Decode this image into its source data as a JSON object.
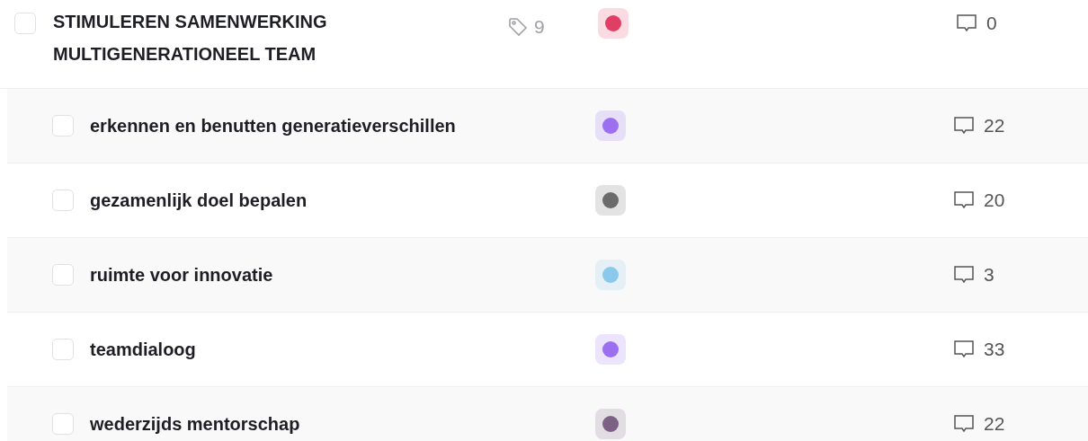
{
  "task": {
    "title": "STIMULEREN SAMENWERKING MULTIGENERATIONEEL TEAM",
    "checked": false,
    "tag_count": "9",
    "color": "#e03e62",
    "comments": "0",
    "children": [
      {
        "title": "erkennen en benutten generatieverschillen",
        "checked": false,
        "color": "#9b6ff0",
        "comments": "22"
      },
      {
        "title": "gezamenlijk doel bepalen",
        "checked": false,
        "color": "#6b6b6b",
        "comments": "20"
      },
      {
        "title": "ruimte voor innovatie",
        "checked": false,
        "color": "#8ac8ec",
        "comments": "3"
      },
      {
        "title": "teamdialoog",
        "checked": false,
        "color": "#9b6ff0",
        "comments": "33"
      },
      {
        "title": "wederzijds mentorschap",
        "checked": false,
        "color": "#7d6184",
        "comments": "22"
      }
    ]
  }
}
